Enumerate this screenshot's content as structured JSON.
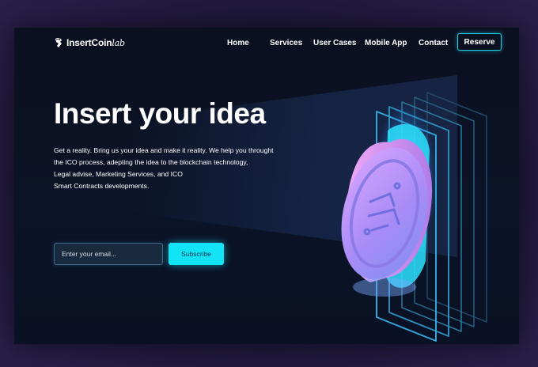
{
  "brand": {
    "logo_main": "InsertCoin",
    "logo_suffix": "lab"
  },
  "nav": {
    "items": [
      {
        "label": "Home"
      },
      {
        "label": "Services"
      },
      {
        "label": "User Cases"
      },
      {
        "label": "Mobile App"
      },
      {
        "label": "Contact"
      }
    ],
    "cta_label": "Reserve"
  },
  "hero": {
    "headline": "Insert your idea",
    "description_lines": [
      "Get a reality. Bring us your idea and make it reality. We help you throught",
      "the ICO process, adepting the idea to the blockchain technology,",
      "Legal advise, Marketing Services, and ICO",
      "Smart Contracts developments."
    ],
    "email_placeholder": "Enter your email...",
    "subscribe_label": "Subscribe"
  },
  "icons": {
    "logo": "coin-hand-icon",
    "illustration": "coin-slot-illustration"
  },
  "colors": {
    "accent": "#12e3f5",
    "background": "#0b1020",
    "coin": "#c58cf0"
  }
}
